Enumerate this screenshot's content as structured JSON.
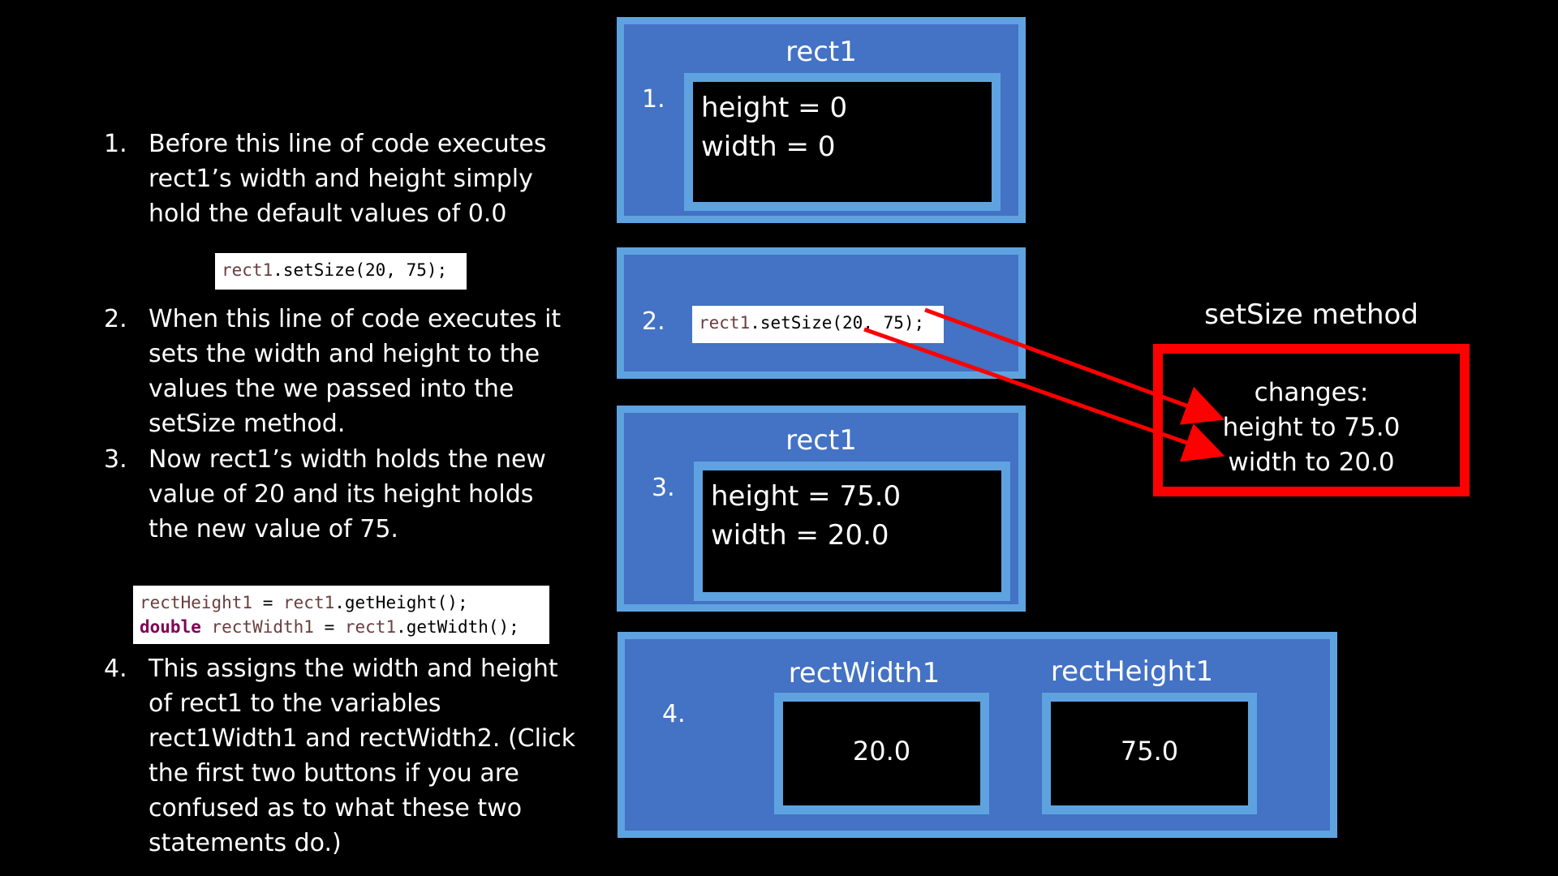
{
  "steps": [
    {
      "num": "1.",
      "text": "Before this line of code executes rect1’s width and height simply hold the default values of 0.0"
    },
    {
      "num": "2.",
      "text": "When this line of code executes it sets the width and height to the values the we passed into the setSize method."
    },
    {
      "num": "3.",
      "text": "Now rect1’s width holds the new value of 20 and its height holds the new value of 75."
    },
    {
      "num": "4.",
      "text": "This assigns the width and height of rect1 to the variables rect1Width1 and rectWidth2. (Click the first two buttons if you are confused as to what these two statements do.)"
    }
  ],
  "code": {
    "setsize_obj": "rect1",
    "setsize_rest": ".setSize(20, 75);",
    "line1_var": "rectHeight1",
    "line1_eq": " = ",
    "line1_obj": "rect1",
    "line1_rest": ".getHeight();",
    "line2_kw": "double",
    "line2_var": " rectWidth1",
    "line2_eq": " = ",
    "line2_obj": "rect1",
    "line2_rest": ".getWidth();"
  },
  "diagram": {
    "panel1": {
      "title": "rect1",
      "num": "1.",
      "height": "height  = 0",
      "width": "width = 0"
    },
    "panel2": {
      "num": "2.",
      "code_obj": "rect1",
      "code_rest": ".setSize(20, 75);"
    },
    "panel3": {
      "title": "rect1",
      "num": "3.",
      "height": "height  = 75.0",
      "width": "width = 20.0"
    },
    "panel4": {
      "num": "4.",
      "box1_label": "rectWidth1",
      "box1_value": "20.0",
      "box2_label": "rectHeight1",
      "box2_value": "75.0"
    }
  },
  "method": {
    "title": "setSize method",
    "line1": "changes:",
    "line2": "height to 75.0",
    "line3": "width to 20.0"
  },
  "colors": {
    "panel_fill": "#4472c4",
    "panel_border": "#5ea3e0",
    "method_border": "#ff0000",
    "arrow": "#ff0000"
  }
}
